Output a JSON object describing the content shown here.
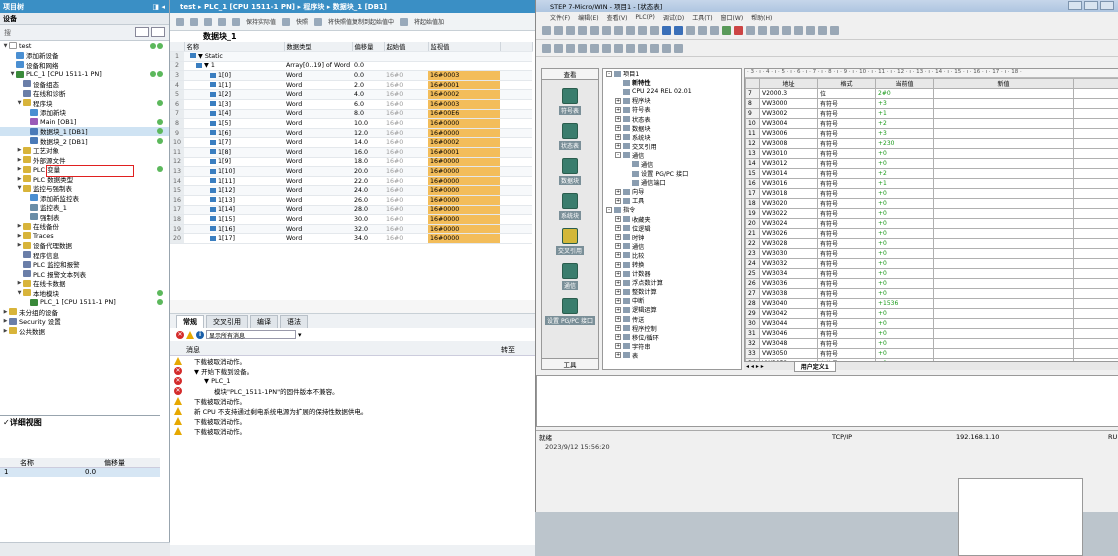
{
  "project_tree": {
    "header": "项目树",
    "devices_label": "设备",
    "search_placeholder": "搜",
    "items": [
      {
        "label": "test",
        "depth": 0,
        "arrow": "▼",
        "color": "#ffffff",
        "status": [
          "#5cb85c",
          "#5cb85c"
        ],
        "selected": false
      },
      {
        "label": "添加新设备",
        "depth": 1,
        "arrow": "",
        "color": "#4a8fd2",
        "status": [],
        "selected": false
      },
      {
        "label": "设备和网络",
        "depth": 1,
        "arrow": "",
        "color": "#4a8fd2",
        "status": [],
        "selected": false
      },
      {
        "label": "PLC_1 [CPU 1511-1 PN]",
        "depth": 1,
        "arrow": "▼",
        "color": "#3a8a3a",
        "status": [
          "#5cb85c",
          "#5cb85c"
        ],
        "selected": false
      },
      {
        "label": "设备组态",
        "depth": 2,
        "arrow": "",
        "color": "#6a7ea8",
        "status": [],
        "selected": false
      },
      {
        "label": "在线和诊断",
        "depth": 2,
        "arrow": "",
        "color": "#6a7ea8",
        "status": [],
        "selected": false
      },
      {
        "label": "程序块",
        "depth": 2,
        "arrow": "▼",
        "color": "#d8b43a",
        "status": [
          "#5cb85c"
        ],
        "selected": false
      },
      {
        "label": "添加新块",
        "depth": 3,
        "arrow": "",
        "color": "#4a8fd2",
        "status": [],
        "selected": false
      },
      {
        "label": "Main [OB1]",
        "depth": 3,
        "arrow": "",
        "color": "#9a5ab8",
        "status": [
          "#5cb85c"
        ],
        "selected": false
      },
      {
        "label": "数据块_1 [DB1]",
        "depth": 3,
        "arrow": "",
        "color": "#4a7ab8",
        "status": [
          "#5cb85c"
        ],
        "selected": true
      },
      {
        "label": "数据块_2 [DB1]",
        "depth": 3,
        "arrow": "",
        "color": "#4a7ab8",
        "status": [
          "#5cb85c"
        ],
        "selected": false
      },
      {
        "label": "工艺对象",
        "depth": 2,
        "arrow": "▶",
        "color": "#d8b43a",
        "status": [],
        "selected": false
      },
      {
        "label": "外部源文件",
        "depth": 2,
        "arrow": "▶",
        "color": "#d8b43a",
        "status": [],
        "selected": false
      },
      {
        "label": "PLC 变量",
        "depth": 2,
        "arrow": "▶",
        "color": "#d8b43a",
        "status": [
          "#5cb85c"
        ],
        "selected": false
      },
      {
        "label": "PLC 数据类型",
        "depth": 2,
        "arrow": "▶",
        "color": "#d8b43a",
        "status": [],
        "selected": false
      },
      {
        "label": "监控与强制表",
        "depth": 2,
        "arrow": "▼",
        "color": "#d8b43a",
        "status": [],
        "selected": false
      },
      {
        "label": "添加新监控表",
        "depth": 3,
        "arrow": "",
        "color": "#4a8fd2",
        "status": [],
        "selected": false
      },
      {
        "label": "监控表_1",
        "depth": 3,
        "arrow": "",
        "color": "#6a8ea8",
        "status": [],
        "selected": false
      },
      {
        "label": "强制表",
        "depth": 3,
        "arrow": "",
        "color": "#6a8ea8",
        "status": [],
        "selected": false
      },
      {
        "label": "在线备份",
        "depth": 2,
        "arrow": "▶",
        "color": "#d8b43a",
        "status": [],
        "selected": false
      },
      {
        "label": "Traces",
        "depth": 2,
        "arrow": "▶",
        "color": "#d8b43a",
        "status": [],
        "selected": false
      },
      {
        "label": "设备代理数据",
        "depth": 2,
        "arrow": "▶",
        "color": "#d8b43a",
        "status": [],
        "selected": false
      },
      {
        "label": "程序信息",
        "depth": 2,
        "arrow": "",
        "color": "#6a7ea8",
        "status": [],
        "selected": false
      },
      {
        "label": "PLC 监控和报警",
        "depth": 2,
        "arrow": "",
        "color": "#6a7ea8",
        "status": [],
        "selected": false
      },
      {
        "label": "PLC 报警文本列表",
        "depth": 2,
        "arrow": "",
        "color": "#6a7ea8",
        "status": [],
        "selected": false
      },
      {
        "label": "在线卡数据",
        "depth": 2,
        "arrow": "▶",
        "color": "#d8b43a",
        "status": [],
        "selected": false
      },
      {
        "label": "本地模块",
        "depth": 2,
        "arrow": "▼",
        "color": "#d8b43a",
        "status": [
          "#5cb85c"
        ],
        "selected": false
      },
      {
        "label": "PLC_1 [CPU 1511-1 PN]",
        "depth": 3,
        "arrow": "",
        "color": "#3a8a3a",
        "status": [
          "#5cb85c"
        ],
        "selected": false
      },
      {
        "label": "未分组的设备",
        "depth": 0,
        "arrow": "▶",
        "color": "#d8b43a",
        "status": [],
        "selected": false
      },
      {
        "label": "Security 设置",
        "depth": 0,
        "arrow": "▶",
        "color": "#6a7ea8",
        "status": [],
        "selected": false
      },
      {
        "label": "公共数据",
        "depth": 0,
        "arrow": "▶",
        "color": "#d8b43a",
        "status": [],
        "selected": false
      }
    ]
  },
  "detail": {
    "title": "详细视图",
    "col_name": "名称",
    "col_offset": "偏移量",
    "row_name": "1",
    "row_offset": "0.0"
  },
  "editor": {
    "breadcrumb": "test ▸ PLC_1 [CPU 1511-1 PN] ▸ 程序块 ▸ 数据块_1 [DB1]",
    "toolbar": [
      "保持实际值",
      "快照",
      "将快照值复制到起始值中",
      "将起始值加"
    ],
    "block_title": "数据块_1",
    "columns": [
      "名称",
      "数据类型",
      "偏移量",
      "起始值",
      "监视值"
    ],
    "rows": [
      {
        "n": "1",
        "name": "▼ Static",
        "type": "",
        "off": "",
        "start": "",
        "mon": ""
      },
      {
        "n": "2",
        "name": "▼ 1",
        "type": "Array[0..19] of Word",
        "off": "0.0",
        "start": "",
        "mon": ""
      },
      {
        "n": "3",
        "name": "1[0]",
        "type": "Word",
        "off": "0.0",
        "start": "16#0",
        "mon": "16#0003"
      },
      {
        "n": "4",
        "name": "1[1]",
        "type": "Word",
        "off": "2.0",
        "start": "16#0",
        "mon": "16#0001"
      },
      {
        "n": "5",
        "name": "1[2]",
        "type": "Word",
        "off": "4.0",
        "start": "16#0",
        "mon": "16#0002"
      },
      {
        "n": "6",
        "name": "1[3]",
        "type": "Word",
        "off": "6.0",
        "start": "16#0",
        "mon": "16#0003"
      },
      {
        "n": "7",
        "name": "1[4]",
        "type": "Word",
        "off": "8.0",
        "start": "16#0",
        "mon": "16#00E6"
      },
      {
        "n": "8",
        "name": "1[5]",
        "type": "Word",
        "off": "10.0",
        "start": "16#0",
        "mon": "16#0000"
      },
      {
        "n": "9",
        "name": "1[6]",
        "type": "Word",
        "off": "12.0",
        "start": "16#0",
        "mon": "16#0000"
      },
      {
        "n": "10",
        "name": "1[7]",
        "type": "Word",
        "off": "14.0",
        "start": "16#0",
        "mon": "16#0002"
      },
      {
        "n": "11",
        "name": "1[8]",
        "type": "Word",
        "off": "16.0",
        "start": "16#0",
        "mon": "16#0001"
      },
      {
        "n": "12",
        "name": "1[9]",
        "type": "Word",
        "off": "18.0",
        "start": "16#0",
        "mon": "16#0000"
      },
      {
        "n": "13",
        "name": "1[10]",
        "type": "Word",
        "off": "20.0",
        "start": "16#0",
        "mon": "16#0000"
      },
      {
        "n": "14",
        "name": "1[11]",
        "type": "Word",
        "off": "22.0",
        "start": "16#0",
        "mon": "16#0000"
      },
      {
        "n": "15",
        "name": "1[12]",
        "type": "Word",
        "off": "24.0",
        "start": "16#0",
        "mon": "16#0000"
      },
      {
        "n": "16",
        "name": "1[13]",
        "type": "Word",
        "off": "26.0",
        "start": "16#0",
        "mon": "16#0000"
      },
      {
        "n": "17",
        "name": "1[14]",
        "type": "Word",
        "off": "28.0",
        "start": "16#0",
        "mon": "16#0000"
      },
      {
        "n": "18",
        "name": "1[15]",
        "type": "Word",
        "off": "30.0",
        "start": "16#0",
        "mon": "16#0000"
      },
      {
        "n": "19",
        "name": "1[16]",
        "type": "Word",
        "off": "32.0",
        "start": "16#0",
        "mon": "16#0000"
      },
      {
        "n": "20",
        "name": "1[17]",
        "type": "Word",
        "off": "34.0",
        "start": "16#0",
        "mon": "16#0000"
      }
    ],
    "tabs": [
      "常规",
      "交叉引用",
      "编译",
      "语法"
    ],
    "filter_label": "显示所有消息",
    "msg_header": "消息",
    "msg_goto": "转至",
    "messages": [
      {
        "icon": "warn",
        "indent": 0,
        "text": "下载被取消动作。"
      },
      {
        "icon": "error",
        "indent": 0,
        "text": "▼ 开始下载到设备。"
      },
      {
        "icon": "error",
        "indent": 1,
        "text": "▼ PLC_1"
      },
      {
        "icon": "error",
        "indent": 2,
        "text": "模块\"PLC_1511-1PN\"的固件版本不兼容。"
      },
      {
        "icon": "warn",
        "indent": 0,
        "text": "下载被取消动作。"
      },
      {
        "icon": "warn",
        "indent": 0,
        "text": "新 CPU 不支持通过剩电系统电源为扩展的保持性数据供电。"
      },
      {
        "icon": "warn",
        "indent": 0,
        "text": "下载被取消动作。"
      },
      {
        "icon": "warn",
        "indent": 0,
        "text": "下载被取消动作。"
      }
    ]
  },
  "step7": {
    "title": "STEP 7-Micro/WIN - 项目1 - [状态表]",
    "menu": [
      "文件(F)",
      "编辑(E)",
      "查看(V)",
      "PLC(P)",
      "调试(D)",
      "工具(T)",
      "窗口(W)",
      "帮助(H)"
    ],
    "nav_header": "查看",
    "nav_buttons": [
      "符号表",
      "状态表",
      "数据块",
      "系统块",
      "交叉引用",
      "通信",
      "设置 PG/PC 接口"
    ],
    "nav_tools": "工具",
    "tree": [
      {
        "pm": "-",
        "depth": 0,
        "label": "项目1"
      },
      {
        "pm": "",
        "depth": 1,
        "label": "新特性"
      },
      {
        "pm": "",
        "depth": 1,
        "label": "CPU 224 REL 02.01"
      },
      {
        "pm": "+",
        "depth": 1,
        "label": "程序块"
      },
      {
        "pm": "+",
        "depth": 1,
        "label": "符号表"
      },
      {
        "pm": "+",
        "depth": 1,
        "label": "状态表"
      },
      {
        "pm": "+",
        "depth": 1,
        "label": "数据块"
      },
      {
        "pm": "+",
        "depth": 1,
        "label": "系统块"
      },
      {
        "pm": "+",
        "depth": 1,
        "label": "交叉引用"
      },
      {
        "pm": "-",
        "depth": 1,
        "label": "通信"
      },
      {
        "pm": "",
        "depth": 2,
        "label": "通信"
      },
      {
        "pm": "",
        "depth": 2,
        "label": "设置 PG/PC 接口"
      },
      {
        "pm": "",
        "depth": 2,
        "label": "通信端口"
      },
      {
        "pm": "+",
        "depth": 1,
        "label": "向导"
      },
      {
        "pm": "+",
        "depth": 1,
        "label": "工具"
      },
      {
        "pm": "-",
        "depth": 0,
        "label": "指令"
      },
      {
        "pm": "+",
        "depth": 1,
        "label": "收藏夹"
      },
      {
        "pm": "+",
        "depth": 1,
        "label": "位逻辑"
      },
      {
        "pm": "+",
        "depth": 1,
        "label": "时钟"
      },
      {
        "pm": "+",
        "depth": 1,
        "label": "通信"
      },
      {
        "pm": "+",
        "depth": 1,
        "label": "比较"
      },
      {
        "pm": "+",
        "depth": 1,
        "label": "转换"
      },
      {
        "pm": "+",
        "depth": 1,
        "label": "计数器"
      },
      {
        "pm": "+",
        "depth": 1,
        "label": "浮点数计算"
      },
      {
        "pm": "+",
        "depth": 1,
        "label": "整数计算"
      },
      {
        "pm": "+",
        "depth": 1,
        "label": "中断"
      },
      {
        "pm": "+",
        "depth": 1,
        "label": "逻辑运算"
      },
      {
        "pm": "+",
        "depth": 1,
        "label": "传送"
      },
      {
        "pm": "+",
        "depth": 1,
        "label": "程序控制"
      },
      {
        "pm": "+",
        "depth": 1,
        "label": "移位/循环"
      },
      {
        "pm": "+",
        "depth": 1,
        "label": "字符串"
      },
      {
        "pm": "+",
        "depth": 1,
        "label": "表"
      }
    ],
    "ruler": "· 3 · ı · 4 · ı · 5 · ı · 6 · ı · 7 · ı · 8 · ı · 9 · ı · 10 · ı · 11 · ı · 12 · ı · 13 · ı · 14 · ı · 15 · ı · 16 · ı · 17 · ı · 18 ·",
    "table_cols": [
      "地址",
      "格式",
      "当前值",
      "新值"
    ],
    "table_rows": [
      {
        "n": "7",
        "addr": "V2000.3",
        "fmt": "位",
        "val": "2#0"
      },
      {
        "n": "8",
        "addr": "VW3000",
        "fmt": "有符号",
        "val": "+3"
      },
      {
        "n": "9",
        "addr": "VW3002",
        "fmt": "有符号",
        "val": "+1"
      },
      {
        "n": "10",
        "addr": "VW3004",
        "fmt": "有符号",
        "val": "+2"
      },
      {
        "n": "11",
        "addr": "VW3006",
        "fmt": "有符号",
        "val": "+3"
      },
      {
        "n": "12",
        "addr": "VW3008",
        "fmt": "有符号",
        "val": "+230"
      },
      {
        "n": "13",
        "addr": "VW3010",
        "fmt": "有符号",
        "val": "+0"
      },
      {
        "n": "14",
        "addr": "VW3012",
        "fmt": "有符号",
        "val": "+0"
      },
      {
        "n": "15",
        "addr": "VW3014",
        "fmt": "有符号",
        "val": "+2"
      },
      {
        "n": "16",
        "addr": "VW3016",
        "fmt": "有符号",
        "val": "+1"
      },
      {
        "n": "17",
        "addr": "VW3018",
        "fmt": "有符号",
        "val": "+0"
      },
      {
        "n": "18",
        "addr": "VW3020",
        "fmt": "有符号",
        "val": "+0"
      },
      {
        "n": "19",
        "addr": "VW3022",
        "fmt": "有符号",
        "val": "+0"
      },
      {
        "n": "20",
        "addr": "VW3024",
        "fmt": "有符号",
        "val": "+0"
      },
      {
        "n": "21",
        "addr": "VW3026",
        "fmt": "有符号",
        "val": "+0"
      },
      {
        "n": "22",
        "addr": "VW3028",
        "fmt": "有符号",
        "val": "+0"
      },
      {
        "n": "23",
        "addr": "VW3030",
        "fmt": "有符号",
        "val": "+0"
      },
      {
        "n": "24",
        "addr": "VW3032",
        "fmt": "有符号",
        "val": "+0"
      },
      {
        "n": "25",
        "addr": "VW3034",
        "fmt": "有符号",
        "val": "+0"
      },
      {
        "n": "26",
        "addr": "VW3036",
        "fmt": "有符号",
        "val": "+0"
      },
      {
        "n": "27",
        "addr": "VW3038",
        "fmt": "有符号",
        "val": "+0"
      },
      {
        "n": "28",
        "addr": "VW3040",
        "fmt": "有符号",
        "val": "+1536"
      },
      {
        "n": "29",
        "addr": "VW3042",
        "fmt": "有符号",
        "val": "+0"
      },
      {
        "n": "30",
        "addr": "VW3044",
        "fmt": "有符号",
        "val": "+0"
      },
      {
        "n": "31",
        "addr": "VW3046",
        "fmt": "有符号",
        "val": "+0"
      },
      {
        "n": "32",
        "addr": "VW3048",
        "fmt": "有符号",
        "val": "+0"
      },
      {
        "n": "33",
        "addr": "VW3050",
        "fmt": "有符号",
        "val": "+0"
      },
      {
        "n": "34",
        "addr": "VW3052",
        "fmt": "有符号",
        "val": "+0"
      }
    ],
    "sheet_tab": "用户定义1",
    "status_ready": "就绪",
    "status_proto": "TCP/IP",
    "status_ip": "192.168.1.10",
    "status_ru": "RU",
    "datetime": "2023/9/12   15:56:20"
  }
}
